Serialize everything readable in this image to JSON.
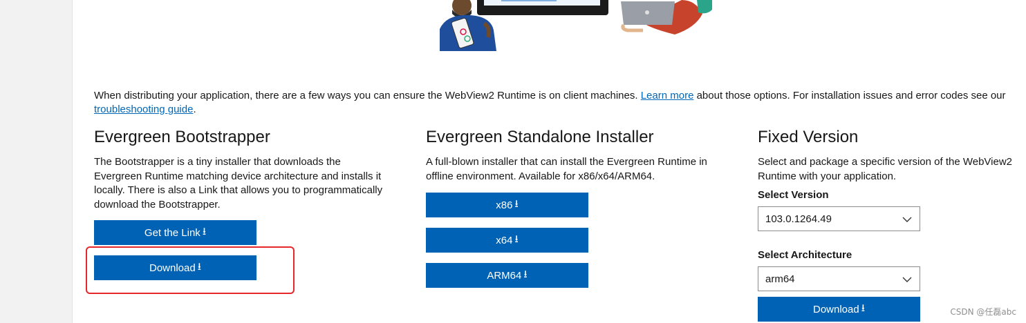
{
  "intro": {
    "text_before": "When distributing your application, there are a few ways you can ensure the WebView2 Runtime is on client machines. ",
    "learn_more_link": "Learn more",
    "text_middle": " about those options. For installation issues and error codes see our ",
    "troubleshooting_link": "troubleshooting guide",
    "text_after": "."
  },
  "bootstrapper": {
    "title": "Evergreen Bootstrapper",
    "description": "The Bootstrapper is a tiny installer that downloads the Evergreen Runtime matching device architecture and installs it locally. There is also a Link that allows you to programmatically download the Bootstrapper.",
    "get_link_label": "Get the Link",
    "download_label": "Download"
  },
  "standalone": {
    "title": "Evergreen Standalone Installer",
    "description": "A full-blown installer that can install the Evergreen Runtime in offline environment. Available for x86/x64/ARM64.",
    "buttons": [
      "x86",
      "x64",
      "ARM64"
    ]
  },
  "fixed": {
    "title": "Fixed Version",
    "description": "Select and package a specific version of the WebView2 Runtime with your application.",
    "version_label": "Select Version",
    "version_value": "103.0.1264.49",
    "arch_label": "Select Architecture",
    "arch_value": "arm64",
    "download_label": "Download"
  },
  "icons": {
    "download": "download-arrow-icon",
    "dropdown": "chevron-down-icon"
  },
  "colors": {
    "accent": "#0062b4",
    "link": "#0067b8",
    "highlight": "#e5262a"
  },
  "watermark": "CSDN @任磊abc"
}
